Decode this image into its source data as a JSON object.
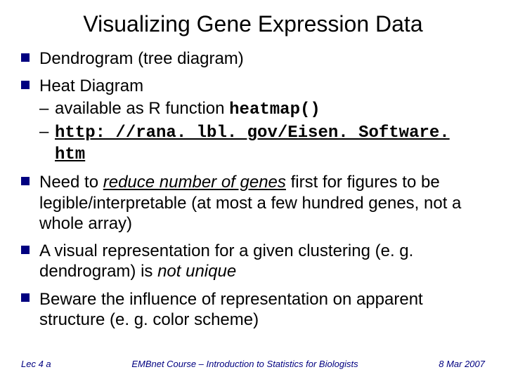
{
  "title": "Visualizing Gene Expression Data",
  "bullets": {
    "b1": "Dendrogram (tree diagram)",
    "b2": "Heat Diagram",
    "b2a_pre": "available as R function  ",
    "b2a_code": "heatmap()",
    "b2b_url": "http: //rana. lbl. gov/Eisen. Software. htm",
    "b3_pre": "Need to ",
    "b3_em": "reduce number of genes",
    "b3_post": " first for figures to be legible/interpretable (at most a few hundred genes, not a whole array)",
    "b4_pre": "A visual representation for a given clustering (e. g. dendrogram) is ",
    "b4_em": "not unique",
    "b5": "Beware the influence of representation on apparent structure (e. g. color scheme)"
  },
  "footer": {
    "left": "Lec 4 a",
    "center": "EMBnet Course – Introduction to Statistics for Biologists",
    "right": "8 Mar 2007"
  }
}
